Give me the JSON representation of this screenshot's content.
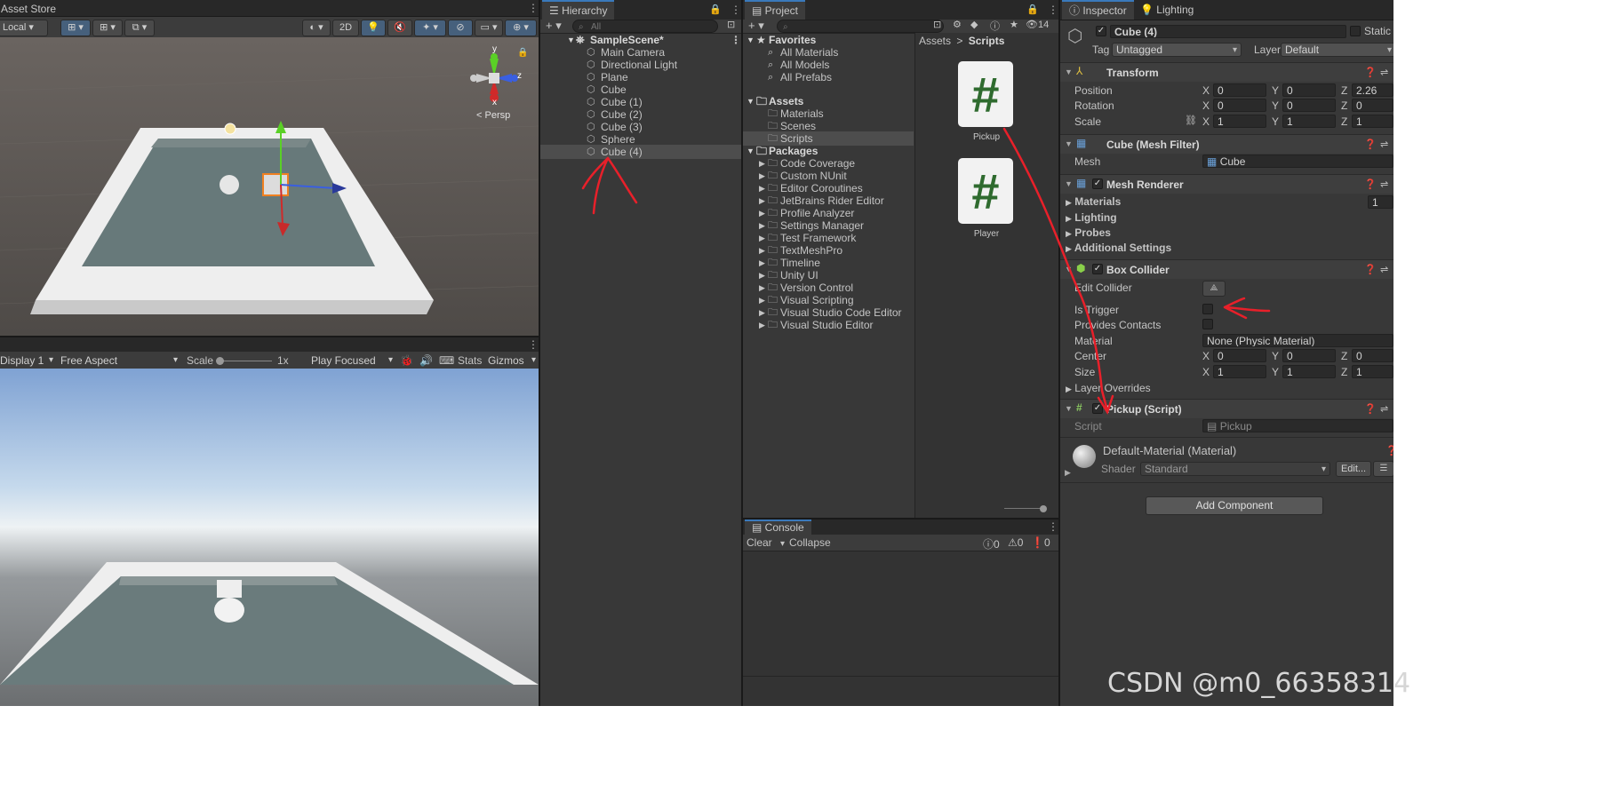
{
  "scene": {
    "tab_label": "Asset Store",
    "pivot_label": "Local",
    "mode_2d": "2D",
    "gizmo_axes": {
      "y": "y",
      "z": "z",
      "x": "x"
    },
    "persp_label": "Persp"
  },
  "game": {
    "display_label": "Display 1",
    "aspect_label": "Free Aspect",
    "scale_label": "Scale",
    "scale_value": "1x",
    "play_mode_label": "Play Focused",
    "stats_label": "Stats",
    "gizmos_label": "Gizmos"
  },
  "hierarchy": {
    "tab_label": "Hierarchy",
    "search_placeholder": "All",
    "scene_name": "SampleScene*",
    "items": [
      "Main Camera",
      "Directional Light",
      "Plane",
      "Cube",
      "Cube (1)",
      "Cube (2)",
      "Cube (3)",
      "Sphere",
      "Cube (4)"
    ]
  },
  "project": {
    "tab_label": "Project",
    "hidden_count": "14",
    "favorites_label": "Favorites",
    "favorites": [
      "All Materials",
      "All Models",
      "All Prefabs"
    ],
    "assets_label": "Assets",
    "assets": [
      "Materials",
      "Scenes",
      "Scripts"
    ],
    "packages_label": "Packages",
    "packages": [
      "Code Coverage",
      "Custom NUnit",
      "Editor Coroutines",
      "JetBrains Rider Editor",
      "Profile Analyzer",
      "Settings Manager",
      "Test Framework",
      "TextMeshPro",
      "Timeline",
      "Unity UI",
      "Version Control",
      "Visual Scripting",
      "Visual Studio Code Editor",
      "Visual Studio Editor"
    ],
    "breadcrumb_root": "Assets",
    "breadcrumb_sep": ">",
    "breadcrumb_current": "Scripts",
    "files": [
      {
        "name": "Pickup",
        "glyph": "#"
      },
      {
        "name": "Player",
        "glyph": "#"
      }
    ]
  },
  "console": {
    "tab_label": "Console",
    "clear_label": "Clear",
    "collapse_label": "Collapse",
    "info_count": "0",
    "warn_count": "0",
    "error_count": "0"
  },
  "inspector": {
    "tab_label": "Inspector",
    "lighting_tab_label": "Lighting",
    "object_name": "Cube (4)",
    "static_label": "Static",
    "tag_label": "Tag",
    "tag_value": "Untagged",
    "layer_label": "Layer",
    "layer_value": "Default",
    "transform": {
      "title": "Transform",
      "position_label": "Position",
      "rotation_label": "Rotation",
      "scale_label": "Scale",
      "position": {
        "x": "0",
        "y": "0",
        "z": "2.26"
      },
      "rotation": {
        "x": "0",
        "y": "0",
        "z": "0"
      },
      "scale": {
        "x": "1",
        "y": "1",
        "z": "1"
      }
    },
    "mesh_filter": {
      "title": "Cube (Mesh Filter)",
      "mesh_label": "Mesh",
      "mesh_value": "Cube"
    },
    "mesh_renderer": {
      "title": "Mesh Renderer",
      "materials_label": "Materials",
      "materials_count": "1",
      "lighting_label": "Lighting",
      "probes_label": "Probes",
      "additional_label": "Additional Settings"
    },
    "box_collider": {
      "title": "Box Collider",
      "edit_label": "Edit Collider",
      "is_trigger_label": "Is Trigger",
      "provides_contacts_label": "Provides Contacts",
      "material_label": "Material",
      "material_value": "None (Physic Material)",
      "center_label": "Center",
      "center": {
        "x": "0",
        "y": "0",
        "z": "0"
      },
      "size_label": "Size",
      "size": {
        "x": "1",
        "y": "1",
        "z": "1"
      },
      "layer_overrides_label": "Layer Overrides"
    },
    "pickup_script": {
      "title": "Pickup (Script)",
      "script_label": "Script",
      "script_value": "Pickup"
    },
    "material": {
      "name": "Default-Material (Material)",
      "shader_label": "Shader",
      "shader_value": "Standard",
      "edit_label": "Edit..."
    },
    "add_component_label": "Add Component",
    "axis_x": "X",
    "axis_y": "Y",
    "axis_z": "Z"
  },
  "watermark": "CSDN @m0_66358314",
  "colors": {
    "selection": "#4d4d4d",
    "accent": "#3a79bb",
    "annotation": "#e8202a",
    "script_green": "#2f6b2f"
  }
}
